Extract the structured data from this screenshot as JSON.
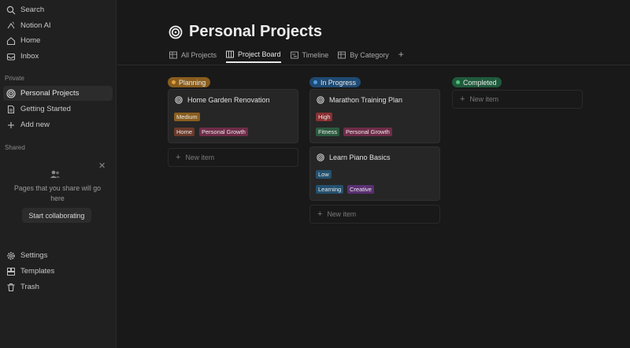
{
  "sidebar": {
    "nav": [
      {
        "label": "Search",
        "icon": "search-icon"
      },
      {
        "label": "Notion AI",
        "icon": "sparkle-icon"
      },
      {
        "label": "Home",
        "icon": "home-icon"
      },
      {
        "label": "Inbox",
        "icon": "inbox-icon"
      }
    ],
    "private_label": "Private",
    "private_items": [
      {
        "label": "Personal Projects",
        "icon": "target-icon"
      },
      {
        "label": "Getting Started",
        "icon": "page-icon"
      },
      {
        "label": "Add new",
        "icon": "plus-icon"
      }
    ],
    "shared_label": "Shared",
    "share_text": "Pages that you share will go here",
    "share_button": "Start collaborating",
    "bottom_items": [
      {
        "label": "Settings",
        "icon": "gear-icon"
      },
      {
        "label": "Templates",
        "icon": "templates-icon"
      },
      {
        "label": "Trash",
        "icon": "trash-icon"
      }
    ]
  },
  "page": {
    "title": "Personal Projects",
    "tabs": [
      {
        "label": "All Projects",
        "icon": "table-icon"
      },
      {
        "label": "Project Board",
        "icon": "board-icon"
      },
      {
        "label": "Timeline",
        "icon": "timeline-icon"
      },
      {
        "label": "By Category",
        "icon": "table-icon"
      }
    ],
    "tab_add": "+"
  },
  "board": {
    "new_item_label": "New item",
    "columns": [
      {
        "name": "Planning",
        "pill_color": "#8a5d1e",
        "dot_color": "#e0a040",
        "cards": [
          {
            "title": "Home Garden Renovation",
            "priority": "Medium",
            "tags": [
              "Home",
              "Personal Growth"
            ]
          }
        ]
      },
      {
        "name": "In Progress",
        "pill_color": "#1f4a73",
        "dot_color": "#4d9be0",
        "cards": [
          {
            "title": "Marathon Training Plan",
            "priority": "High",
            "tags": [
              "Fitness",
              "Personal Growth"
            ]
          },
          {
            "title": "Learn Piano Basics",
            "priority": "Low",
            "tags": [
              "Learning",
              "Creative"
            ]
          }
        ]
      },
      {
        "name": "Completed",
        "pill_color": "#1f5a3c",
        "dot_color": "#4fbf7a",
        "cards": []
      }
    ]
  },
  "colors": {
    "priority_medium": "#8a5d1e",
    "priority_high": "#8a2f32",
    "priority_low": "#24506e",
    "tag_home": "#6b3a2a",
    "tag_personal_growth": "#6e2c48",
    "tag_fitness": "#2b5a3e",
    "tag_learning": "#24506e",
    "tag_creative": "#5a2f72"
  }
}
